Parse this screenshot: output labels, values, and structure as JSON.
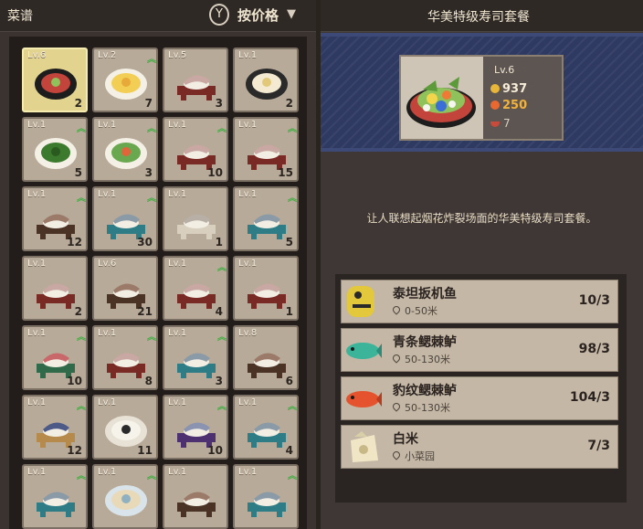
{
  "left": {
    "title": "菜谱",
    "sort_key": "Y",
    "sort_label": "按价格",
    "sort_caret": "▼"
  },
  "recipes": [
    {
      "level": "Lv.6",
      "count": "2",
      "upgrade": false,
      "selected": true,
      "art": "sushi-platter"
    },
    {
      "level": "Lv.2",
      "count": "7",
      "upgrade": true,
      "art": "omelet-plate"
    },
    {
      "level": "Lv.5",
      "count": "3",
      "upgrade": false,
      "art": "nigiri-red"
    },
    {
      "level": "Lv.1",
      "count": "2",
      "upgrade": false,
      "art": "flower-plate"
    },
    {
      "level": "Lv.1",
      "count": "5",
      "upgrade": true,
      "art": "green-plate"
    },
    {
      "level": "Lv.1",
      "count": "3",
      "upgrade": true,
      "art": "salad-plate"
    },
    {
      "level": "Lv.1",
      "count": "10",
      "upgrade": true,
      "art": "nigiri-red"
    },
    {
      "level": "Lv.1",
      "count": "15",
      "upgrade": true,
      "art": "nigiri-red"
    },
    {
      "level": "Lv.1",
      "count": "12",
      "upgrade": true,
      "art": "nigiri-brown"
    },
    {
      "level": "Lv.1",
      "count": "30",
      "upgrade": true,
      "art": "nigiri-teal"
    },
    {
      "level": "Lv.1",
      "count": "1",
      "upgrade": false,
      "art": "nigiri-cream"
    },
    {
      "level": "Lv.1",
      "count": "5",
      "upgrade": true,
      "art": "nigiri-teal"
    },
    {
      "level": "Lv.1",
      "count": "2",
      "upgrade": false,
      "art": "nigiri-red"
    },
    {
      "level": "Lv.6",
      "count": "21",
      "upgrade": false,
      "art": "nigiri-brown"
    },
    {
      "level": "Lv.1",
      "count": "4",
      "upgrade": true,
      "art": "nigiri-red"
    },
    {
      "level": "Lv.1",
      "count": "1",
      "upgrade": false,
      "art": "nigiri-red"
    },
    {
      "level": "Lv.1",
      "count": "10",
      "upgrade": true,
      "art": "nigiri-green"
    },
    {
      "level": "Lv.1",
      "count": "8",
      "upgrade": true,
      "art": "nigiri-red"
    },
    {
      "level": "Lv.1",
      "count": "3",
      "upgrade": true,
      "art": "nigiri-teal"
    },
    {
      "level": "Lv.8",
      "count": "6",
      "upgrade": false,
      "art": "nigiri-brown"
    },
    {
      "level": "Lv.1",
      "count": "12",
      "upgrade": true,
      "art": "nigiri-wood"
    },
    {
      "level": "Lv.1",
      "count": "11",
      "upgrade": false,
      "art": "onigiri-plate"
    },
    {
      "level": "Lv.1",
      "count": "10",
      "upgrade": true,
      "art": "nigiri-purple"
    },
    {
      "level": "Lv.1",
      "count": "4",
      "upgrade": true,
      "art": "nigiri-teal"
    },
    {
      "level": "Lv.1",
      "count": "",
      "upgrade": true,
      "art": "nigiri-teal"
    },
    {
      "level": "Lv.1",
      "count": "",
      "upgrade": true,
      "art": "bowl-plate"
    },
    {
      "level": "Lv.1",
      "count": "",
      "upgrade": false,
      "art": "nigiri-brown"
    },
    {
      "level": "Lv.1",
      "count": "",
      "upgrade": true,
      "art": "nigiri-teal"
    }
  ],
  "detail": {
    "title": "华美特级寿司套餐",
    "level": "Lv.6",
    "price": "937",
    "reputation": "250",
    "servings": "7",
    "description": "让人联想起烟花炸裂场面的华美特级寿司套餐。"
  },
  "ingredients": [
    {
      "name": "泰坦扳机鱼",
      "location": "0-50米",
      "count": "10/3",
      "icon": "titan-triggerfish"
    },
    {
      "name": "青条鳃棘鲈",
      "location": "50-130米",
      "count": "98/3",
      "icon": "blue-coral-trout"
    },
    {
      "name": "豹纹鳃棘鲈",
      "location": "50-130米",
      "count": "104/3",
      "icon": "leopard-coral-trout"
    },
    {
      "name": "白米",
      "location": "小菜园",
      "count": "7/3",
      "icon": "rice-sack"
    }
  ],
  "colors": {
    "accent_green": "#3fae42",
    "coin": "#e8b638",
    "reputation": "#f3b33a",
    "banner": "#2f3a63"
  }
}
